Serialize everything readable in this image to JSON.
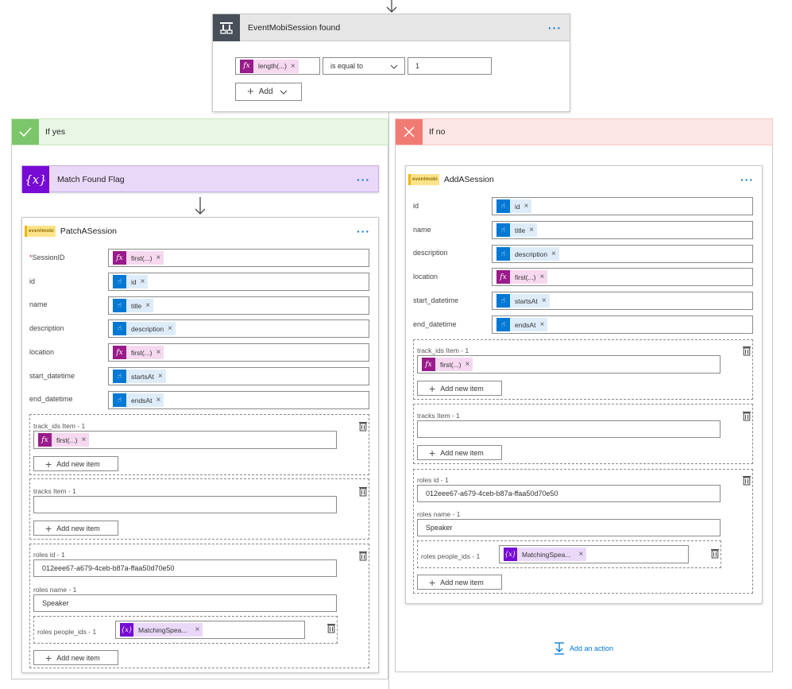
{
  "condition": {
    "title": "EventMobiSession found",
    "left_token": "length(...)",
    "operator": "is equal to",
    "right_value": "1",
    "add_label": "Add"
  },
  "branch_yes": {
    "label": "If yes",
    "variable_card": {
      "title": "Match Found Flag"
    },
    "patch": {
      "title": "PatchASession",
      "fields": [
        {
          "label": "SessionID",
          "required": true,
          "token": "first(...)",
          "kind": "fx"
        },
        {
          "label": "id",
          "token": "id",
          "kind": "dyn"
        },
        {
          "label": "name",
          "token": "title",
          "kind": "dyn"
        },
        {
          "label": "description",
          "token": "description",
          "kind": "dyn"
        },
        {
          "label": "location",
          "token": "first(...)",
          "kind": "fx"
        },
        {
          "label": "start_datetime",
          "token": "startsAt",
          "kind": "dyn"
        },
        {
          "label": "end_datetime",
          "token": "endsAt",
          "kind": "dyn"
        }
      ],
      "track_ids_label": "track_ids Item - 1",
      "track_ids_token": "first(...)",
      "tracks_label": "tracks Item - 1",
      "roles_id_label": "roles id - 1",
      "roles_id_value": "012eee67-a679-4ceb-b87a-ffaa50d70e50",
      "roles_name_label": "roles name - 1",
      "roles_name_value": "Speaker",
      "roles_people_label": "roles people_ids - 1",
      "roles_people_token": "MatchingSpea...",
      "add_new_item": "Add new item"
    }
  },
  "branch_no": {
    "label": "If no",
    "add": {
      "title": "AddASession",
      "fields": [
        {
          "label": "id",
          "token": "id",
          "kind": "dyn"
        },
        {
          "label": "name",
          "token": "title",
          "kind": "dyn"
        },
        {
          "label": "description",
          "token": "description",
          "kind": "dyn"
        },
        {
          "label": "location",
          "token": "first(...)",
          "kind": "fx"
        },
        {
          "label": "start_datetime",
          "token": "startsAt",
          "kind": "dyn"
        },
        {
          "label": "end_datetime",
          "token": "endsAt",
          "kind": "dyn"
        }
      ],
      "track_ids_label": "track_ids Item - 1",
      "track_ids_token": "first(...)",
      "tracks_label": "tracks Item - 1",
      "roles_id_label": "roles id - 1",
      "roles_id_value": "012eee67-a679-4ceb-b87a-ffaa50d70e50",
      "roles_name_label": "roles name - 1",
      "roles_name_value": "Speaker",
      "roles_people_label": "roles people_ids - 1",
      "roles_people_token": "MatchingSpea...",
      "add_new_item": "Add new item"
    },
    "add_action": "Add an action"
  },
  "logo_text": "eventmobi",
  "colors": {
    "accent": "#0078d4",
    "condition_icon": "#484f58",
    "variable_purple": "#770bd6",
    "fx_magenta": "#9a1b8a",
    "yes_green": "#e9f6e5",
    "no_red": "#fde7e6"
  }
}
